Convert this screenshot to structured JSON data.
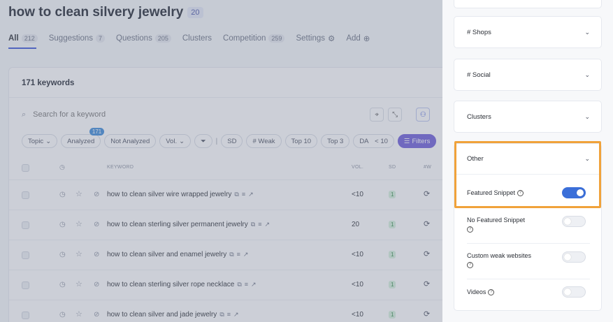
{
  "page": {
    "title": "how to clean silvery jewelry",
    "title_count": "20"
  },
  "tabs": [
    {
      "label": "All",
      "count": "212"
    },
    {
      "label": "Suggestions",
      "count": "7"
    },
    {
      "label": "Questions",
      "count": "205"
    },
    {
      "label": "Clusters",
      "count": ""
    },
    {
      "label": "Competition",
      "count": "259"
    },
    {
      "label": "Settings",
      "count": ""
    },
    {
      "label": "Add",
      "count": ""
    }
  ],
  "panel": {
    "keyword_count": "171 keywords",
    "search_placeholder": "Search for a keyword",
    "filters": {
      "topic": "Topic",
      "analyzed": "Analyzed",
      "analyzed_badge": "171",
      "not_analyzed": "Not Analyzed",
      "vol": "Vol.",
      "sd": "SD",
      "weak": "# Weak",
      "top10": "Top 10",
      "top3": "Top 3",
      "da": "DA",
      "da_value": "< 10",
      "filters_btn": "Filters"
    },
    "columns": {
      "keyword": "KEYWORD",
      "vol": "VOL.",
      "sd": "SD",
      "weak": "#W"
    },
    "rows": [
      {
        "keyword": "how to clean silver wire wrapped jewelry",
        "vol": "<10",
        "sd": "1"
      },
      {
        "keyword": "how to clean sterling silver permanent jewelry",
        "vol": "20",
        "sd": "1"
      },
      {
        "keyword": "how to clean silver and enamel jewelry",
        "vol": "<10",
        "sd": "1"
      },
      {
        "keyword": "how to clean sterling silver rope necklace",
        "vol": "<10",
        "sd": "1"
      },
      {
        "keyword": "how to clean silver and jade jewelry",
        "vol": "<10",
        "sd": "1"
      }
    ]
  },
  "drawer": {
    "sections": [
      {
        "label": "# Shops"
      },
      {
        "label": "# Social"
      },
      {
        "label": "Clusters"
      }
    ],
    "other": {
      "label": "Other",
      "options": [
        {
          "label": "Featured Snippet",
          "on": true
        },
        {
          "label": "No Featured Snippet",
          "on": false
        },
        {
          "label": "Custom weak websites",
          "on": false
        },
        {
          "label": "Videos",
          "on": false
        }
      ]
    }
  },
  "colors": {
    "accent": "#3b56d9",
    "toggle_on": "#3b6fd9",
    "highlight": "#f0a23a",
    "filters_btn": "#6b5bd8"
  }
}
